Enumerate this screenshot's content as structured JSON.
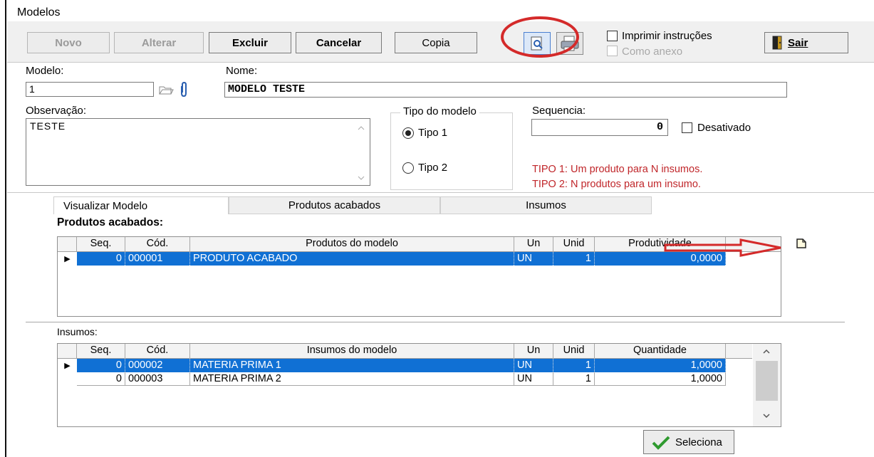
{
  "window": {
    "title": "Modelos"
  },
  "toolbar": {
    "novo": "Novo",
    "alterar": "Alterar",
    "excluir": "Excluir",
    "cancelar": "Cancelar",
    "copia": "Copia",
    "imprimir_instrucoes": "Imprimir instruções",
    "como_anexo": "Como anexo",
    "sair": "Sair",
    "preview_icon": "print-preview-icon",
    "printer_icon": "printer-icon",
    "exit_icon": "exit-door-icon"
  },
  "form": {
    "modelo_label": "Modelo:",
    "modelo_value": "1",
    "nome_label": "Nome:",
    "nome_value": "MODELO TESTE",
    "observacao_label": "Observação:",
    "observacao_value": "TESTE",
    "tipo_group_label": "Tipo do modelo",
    "tipo1_label": "Tipo 1",
    "tipo2_label": "Tipo 2",
    "tipo_selected": "Tipo 1",
    "sequencia_label": "Sequencia:",
    "sequencia_value": "0",
    "desativado_label": "Desativado",
    "tipo1_info": "TIPO 1: Um produto para N insumos.",
    "tipo2_info": "TIPO 2: N produtos para um insumo."
  },
  "tabs": [
    {
      "label": "Visualizar Modelo",
      "active": true
    },
    {
      "label": "Produtos acabados",
      "active": false
    },
    {
      "label": "Insumos",
      "active": false
    }
  ],
  "produtos": {
    "section_label": "Produtos acabados:",
    "columns": [
      "Seq.",
      "Cód.",
      "Produtos do modelo",
      "Un",
      "Unid",
      "Produtividade"
    ],
    "rows": [
      {
        "seq": "0",
        "cod": "000001",
        "desc": "PRODUTO ACABADO",
        "un": "UN",
        "unid": "1",
        "val": "0,0000",
        "selected": true
      }
    ]
  },
  "insumos": {
    "section_label": "Insumos:",
    "columns": [
      "Seq.",
      "Cód.",
      "Insumos do modelo",
      "Un",
      "Unid",
      "Quantidade"
    ],
    "rows": [
      {
        "seq": "0",
        "cod": "000002",
        "desc": "MATERIA PRIMA 1",
        "un": "UN",
        "unid": "1",
        "val": "1,0000",
        "selected": true
      },
      {
        "seq": "0",
        "cod": "000003",
        "desc": "MATERIA PRIMA 2",
        "un": "UN",
        "unid": "1",
        "val": "1,0000",
        "selected": false
      }
    ]
  },
  "seleciona": "Seleciona",
  "colors": {
    "selection": "#1070d4",
    "annotation_red": "#d42a2a",
    "info_red": "#c0262a"
  }
}
